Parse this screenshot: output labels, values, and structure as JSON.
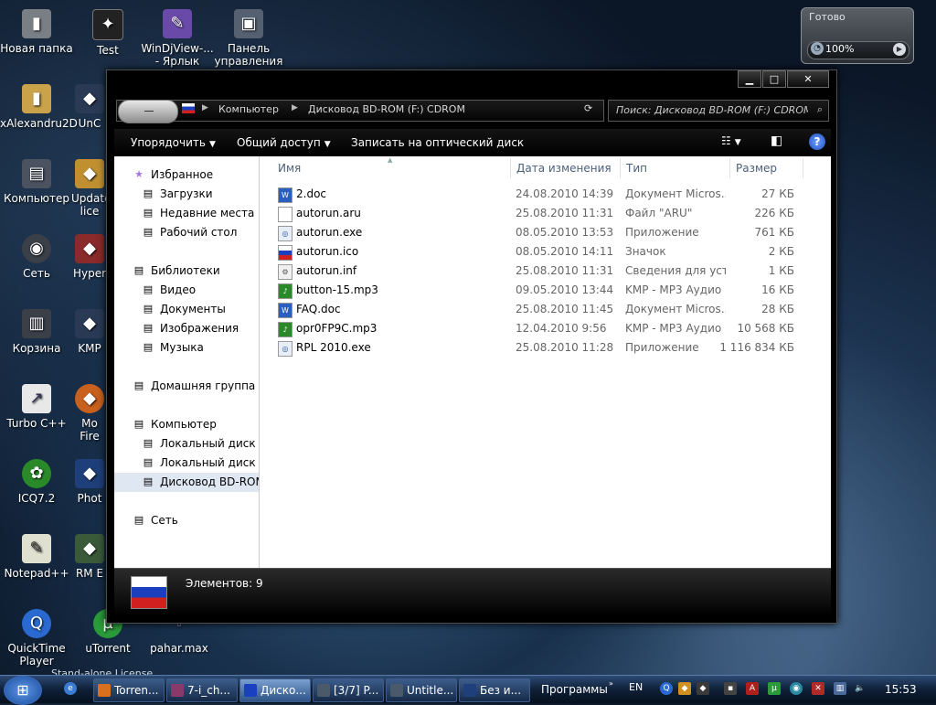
{
  "desktop": {
    "icons": [
      {
        "label": "Новая папка",
        "icon": "folder-icon"
      },
      {
        "label": "Test",
        "icon": "app-icon"
      },
      {
        "label": "WinDjView-... - Ярлык",
        "icon": "shortcut-icon"
      },
      {
        "label": "Панель управления",
        "icon": "control-panel-icon"
      },
      {
        "label": "xAlexandru2D",
        "icon": "folder-icon"
      },
      {
        "label": "UnC",
        "icon": "app-icon"
      },
      {
        "label": "Компьютер",
        "icon": "computer-icon"
      },
      {
        "label": "Update lice",
        "icon": "app-icon"
      },
      {
        "label": "Сеть",
        "icon": "network-icon"
      },
      {
        "label": "Hyper",
        "icon": "app-icon"
      },
      {
        "label": "Корзина",
        "icon": "recycle-bin-icon"
      },
      {
        "label": "KMP",
        "icon": "app-icon"
      },
      {
        "label": "Turbo C++",
        "icon": "shortcut-icon"
      },
      {
        "label": "Mo Fire",
        "icon": "app-icon"
      },
      {
        "label": "ICQ7.2",
        "icon": "icq-icon"
      },
      {
        "label": "Phot",
        "icon": "app-icon"
      },
      {
        "label": "Notepad++",
        "icon": "notepad-icon"
      },
      {
        "label": "RM E",
        "icon": "app-icon"
      },
      {
        "label": "QuickTime Player",
        "icon": "quicktime-icon"
      },
      {
        "label": "uTorrent",
        "icon": "utorrent-icon"
      },
      {
        "label": "pahar.max",
        "icon": "file-icon"
      }
    ]
  },
  "gadget": {
    "title": "Готово",
    "percent": "100%"
  },
  "window": {
    "controls": {
      "minimize": "▁",
      "maximize": "□",
      "close": "✕"
    },
    "address": {
      "crumbs": [
        "Компьютер",
        "Дисковод BD-ROM (F:) CDROM"
      ]
    },
    "search": {
      "placeholder": "Поиск: Дисковод BD-ROM (F:) CDROM"
    },
    "toolbar": {
      "organize": "Упорядочить",
      "share": "Общий доступ",
      "burn": "Записать на оптический диск"
    },
    "nav": {
      "items": [
        {
          "label": "Избранное",
          "level": 0,
          "icon": "star-icon"
        },
        {
          "label": "Загрузки",
          "level": 1,
          "icon": "downloads-icon"
        },
        {
          "label": "Недавние места",
          "level": 1,
          "icon": "recent-places-icon"
        },
        {
          "label": "Рабочий стол",
          "level": 1,
          "icon": "desktop-icon"
        },
        {
          "label": "Библиотеки",
          "level": 0,
          "icon": "libraries-icon"
        },
        {
          "label": "Видео",
          "level": 1,
          "icon": "video-icon"
        },
        {
          "label": "Документы",
          "level": 1,
          "icon": "documents-icon"
        },
        {
          "label": "Изображения",
          "level": 1,
          "icon": "pictures-icon"
        },
        {
          "label": "Музыка",
          "level": 1,
          "icon": "music-icon"
        },
        {
          "label": "Домашняя группа",
          "level": 0,
          "icon": "homegroup-icon"
        },
        {
          "label": "Компьютер",
          "level": 0,
          "icon": "computer-icon"
        },
        {
          "label": "Локальный диск (C",
          "level": 1,
          "icon": "disk-icon"
        },
        {
          "label": "Локальный диск (D",
          "level": 1,
          "icon": "disk-icon"
        },
        {
          "label": "Дисковод BD-ROM",
          "level": 1,
          "icon": "disc-drive-icon"
        },
        {
          "label": "Сеть",
          "level": 0,
          "icon": "network-icon"
        }
      ]
    },
    "columns": {
      "name": "Имя",
      "date": "Дата изменения",
      "type": "Тип",
      "size": "Размер"
    },
    "files": [
      {
        "name": "2.doc",
        "date": "24.08.2010 14:39",
        "type": "Документ Micros...",
        "size": "27 КБ",
        "icon": "word-doc-icon"
      },
      {
        "name": "autorun.aru",
        "date": "25.08.2010 11:31",
        "type": "Файл \"ARU\"",
        "size": "226 КБ",
        "icon": "file-icon"
      },
      {
        "name": "autorun.exe",
        "date": "08.05.2010 13:53",
        "type": "Приложение",
        "size": "761 КБ",
        "icon": "exe-icon"
      },
      {
        "name": "autorun.ico",
        "date": "08.05.2010 14:11",
        "type": "Значок",
        "size": "2 КБ",
        "icon": "flag-icon"
      },
      {
        "name": "autorun.inf",
        "date": "25.08.2010 11:31",
        "type": "Сведения для уст...",
        "size": "1 КБ",
        "icon": "inf-icon"
      },
      {
        "name": "button-15.mp3",
        "date": "09.05.2010 13:44",
        "type": "KMP - MP3 Аудио",
        "size": "16 КБ",
        "icon": "mp3-icon"
      },
      {
        "name": "FAQ.doc",
        "date": "25.08.2010 11:45",
        "type": "Документ Micros...",
        "size": "28 КБ",
        "icon": "word-doc-icon"
      },
      {
        "name": "opr0FP9C.mp3",
        "date": "12.04.2010 9:56",
        "type": "KMP - MP3 Аудио",
        "size": "10 568 КБ",
        "icon": "mp3-icon"
      },
      {
        "name": "RPL 2010.exe",
        "date": "25.08.2010 11:28",
        "type": "Приложение",
        "size": "1 116 834 КБ",
        "icon": "exe-icon"
      }
    ],
    "status": "Элементов: 9"
  },
  "taskbar": {
    "buttons": [
      {
        "label": "Torren...",
        "icon": "firefox-icon",
        "active": false
      },
      {
        "label": "7-i_ch...",
        "icon": "winrar-icon",
        "active": false
      },
      {
        "label": "Диско...",
        "icon": "flag-icon",
        "active": true
      },
      {
        "label": "[3/7] P...",
        "icon": "app-icon",
        "active": false
      },
      {
        "label": "Untitle...",
        "icon": "app-icon",
        "active": false
      },
      {
        "label": "Без и...",
        "icon": "photoshop-icon",
        "active": false
      }
    ],
    "programs_label": "Программы",
    "language": "EN",
    "time": "15:53",
    "sliver_text": "Stand-alone License"
  }
}
